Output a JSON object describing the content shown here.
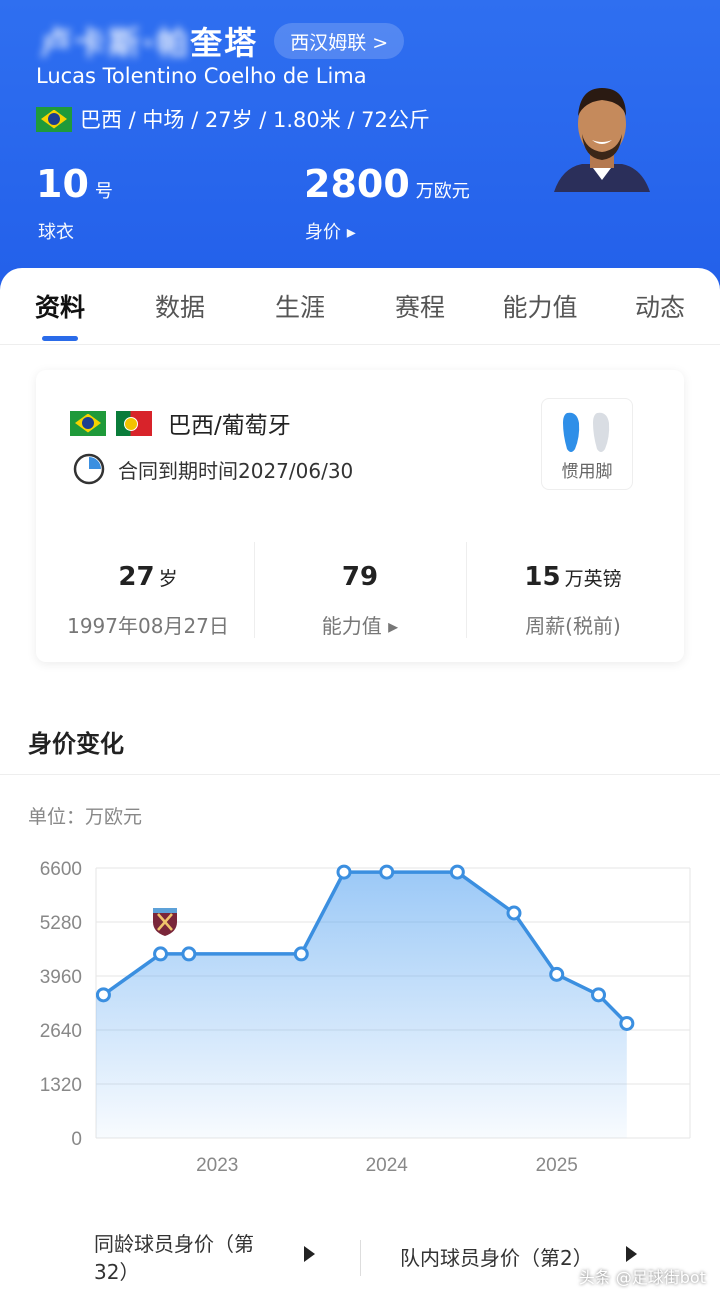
{
  "header": {
    "name_visible": "奎塔",
    "name_hidden": "卢卡斯·帕",
    "league_label": "西汉姆联 >",
    "fullname": "Lucas Tolentino Coelho de Lima",
    "meta": "巴西 / 中场 / 27岁 / 1.80米 / 72公斤",
    "number_value": "10",
    "number_unit": "号",
    "number_label": "球衣",
    "value_value": "2800",
    "value_unit": "万欧元",
    "value_label": "身价 ▸"
  },
  "tabs": [
    {
      "label": "资料",
      "active": true
    },
    {
      "label": "数据",
      "active": false
    },
    {
      "label": "生涯",
      "active": false
    },
    {
      "label": "赛程",
      "active": false
    },
    {
      "label": "能力值",
      "active": false
    },
    {
      "label": "动态",
      "active": false
    }
  ],
  "card": {
    "nationality": "巴西/葡萄牙",
    "contract": "合同到期时间2027/06/30",
    "foot_label": "惯用脚",
    "age_value": "27",
    "age_unit": "岁",
    "birth": "1997年08月27日",
    "rating_value": "79",
    "rating_label": "能力值 ▸",
    "wage_value": "15",
    "wage_unit": "万英镑",
    "wage_label": "周薪(税前)"
  },
  "section": {
    "title": "身价变化",
    "unit": "单位：万欧元"
  },
  "chart_data": {
    "type": "area",
    "x": [
      "2022-05",
      "2022-09",
      "2022-11",
      "2023-07",
      "2023-10",
      "2024-01",
      "2024-06",
      "2024-10",
      "2025-01",
      "2025-04",
      "2025-06"
    ],
    "values": [
      3500,
      4500,
      4500,
      4500,
      6500,
      6500,
      6500,
      5500,
      4000,
      3500,
      2800
    ],
    "yticks": [
      0,
      1320,
      2640,
      3960,
      5280,
      6600
    ],
    "xticks": [
      "2023",
      "2024",
      "2025"
    ],
    "ylim": [
      0,
      6600
    ],
    "grid": true,
    "color": "#3b8fe0"
  },
  "bottom": {
    "peer_label": "同龄球员身价（第32）",
    "team_label": "队内球员身价（第2）"
  },
  "watermark": "头条 @足球街bot"
}
